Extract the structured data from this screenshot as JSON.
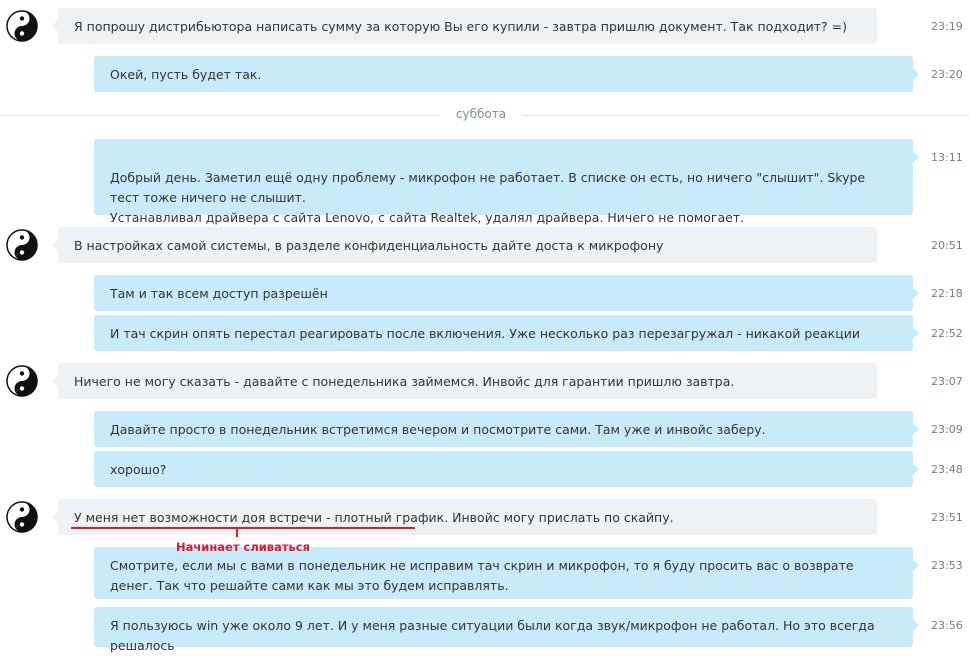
{
  "day_divider": "суббота",
  "messages": [
    {
      "dir": "in",
      "text": "Я попрошу дистрибьютора написать сумму за которую Вы его купили - завтра пришлю документ. Так подходит? =)",
      "time": "23:19"
    },
    {
      "dir": "out",
      "text": "Окей, пусть будет так.",
      "time": "23:20"
    },
    {
      "dir": "out",
      "text": "Добрый день. Заметил ещё одну проблему - микрофон не работает. В списке он есть, но ничего \"слышит\". Skype тест тоже ничего не слышит.\nУстанавливал драйвера с сайта Lenovo, с сайта Realtek, удалял драйвера. Ничего не помогает.",
      "time": "13:11"
    },
    {
      "dir": "in",
      "text": "В настройках самой системы, в разделе конфиденциальность дайте доста к микрофону",
      "time": "20:51"
    },
    {
      "dir": "out",
      "text": "Там и так всем доступ разрешён",
      "time": "22:18"
    },
    {
      "dir": "out",
      "text": "И тач скрин опять перестал реагировать после включения. Уже несколько раз перезагружал - никакой реакции",
      "time": "22:52"
    },
    {
      "dir": "in",
      "text": "Ничего не могу сказать - давайте с понедельника займемся. Инвойс для гарантии пришлю завтра.",
      "time": "23:07"
    },
    {
      "dir": "out",
      "text": "Давайте просто в понедельник встретимся вечером и посмотрите сами. Там уже и инвойс заберу.",
      "time": "23:09"
    },
    {
      "dir": "out",
      "text": "хорошо?",
      "time": "23:48"
    },
    {
      "dir": "in",
      "text": "У меня нет возможности доя встречи - плотный график. Инвойс могу прислать по скайпу.",
      "time": "23:51"
    },
    {
      "dir": "out",
      "text": "Смотрите, если мы с вами в понедельник не исправим тач скрин и микрофон, то я буду просить вас о возврате денег. Так что решайте сами как мы это будем исправлять.",
      "time": "23:53"
    },
    {
      "dir": "out",
      "text": "Я пользуюсь win уже около 9 лет. И у меня разные ситуации были когда звук/микрофон не работал. Но это всегда решалось",
      "time": "23:56"
    }
  ],
  "annotation": {
    "text": "Начинает сливаться",
    "color": "#e0182c"
  },
  "avatar_icon": "yin-yang-icon",
  "colors": {
    "incoming_bubble": "#eff2f5",
    "outgoing_bubble": "#c7ebfb",
    "annotation": "#e0182c"
  }
}
